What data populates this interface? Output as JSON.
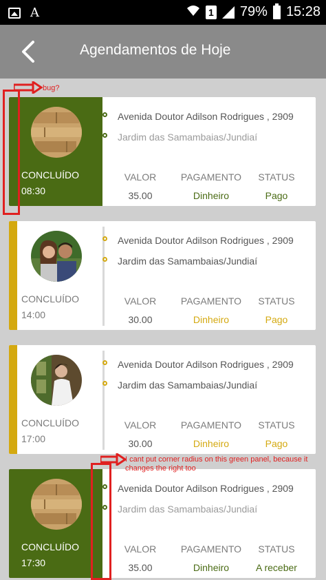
{
  "statusbar": {
    "battery": "79%",
    "time": "15:28",
    "sim": "1",
    "font_icon": "A",
    "icons": [
      "image-icon",
      "font-icon",
      "wifi-icon",
      "sim-icon",
      "signal-icon",
      "battery-icon"
    ]
  },
  "appbar": {
    "title": "Agendamentos de Hoje",
    "back_icon": "back-arrow-icon"
  },
  "colors": {
    "green": "#4a6b14",
    "yellow": "#d4a910",
    "appbar": "#8a8a8a",
    "annotation": "#e02020"
  },
  "columns": {
    "valor": "VALOR",
    "pagamento": "PAGAMENTO",
    "status": "STATUS"
  },
  "cards": [
    {
      "style": "green",
      "image": "bread-photo",
      "status": "CONCLUÍDO",
      "time": "08:30",
      "address1": "Avenida Doutor Adilson Rodrigues , 2909",
      "address2": "Jardim das Samambaias/Jundiaí",
      "valor": "35.00",
      "pagamento": "Dinheiro",
      "status_value": "Pago"
    },
    {
      "style": "yellow",
      "image": "couple-photo",
      "status": "CONCLUÍDO",
      "time": "14:00",
      "address1": "Avenida Doutor Adilson Rodrigues , 2909",
      "address2": "Jardim das Samambaias/Jundiaí",
      "valor": "30.00",
      "pagamento": "Dinheiro",
      "status_value": "Pago"
    },
    {
      "style": "yellow",
      "image": "woman-photo",
      "status": "CONCLUÍDO",
      "time": "17:00",
      "address1": "Avenida Doutor Adilson Rodrigues , 2909",
      "address2": "Jardim das Samambaias/Jundiaí",
      "valor": "30.00",
      "pagamento": "Dinheiro",
      "status_value": "Pago"
    },
    {
      "style": "green",
      "image": "bread-photo",
      "status": "CONCLUÍDO",
      "time": "17:30",
      "address1": "Avenida Doutor Adilson Rodrigues , 2909",
      "address2": "Jardim das Samambaias/Jundiaí",
      "valor": "35.00",
      "pagamento": "Dinheiro",
      "status_value": "A receber"
    }
  ],
  "annotations": {
    "bug": "bug?",
    "corner_line1": "I cant put corner radius on this green panel, because it",
    "corner_line2": "changes the right too"
  }
}
